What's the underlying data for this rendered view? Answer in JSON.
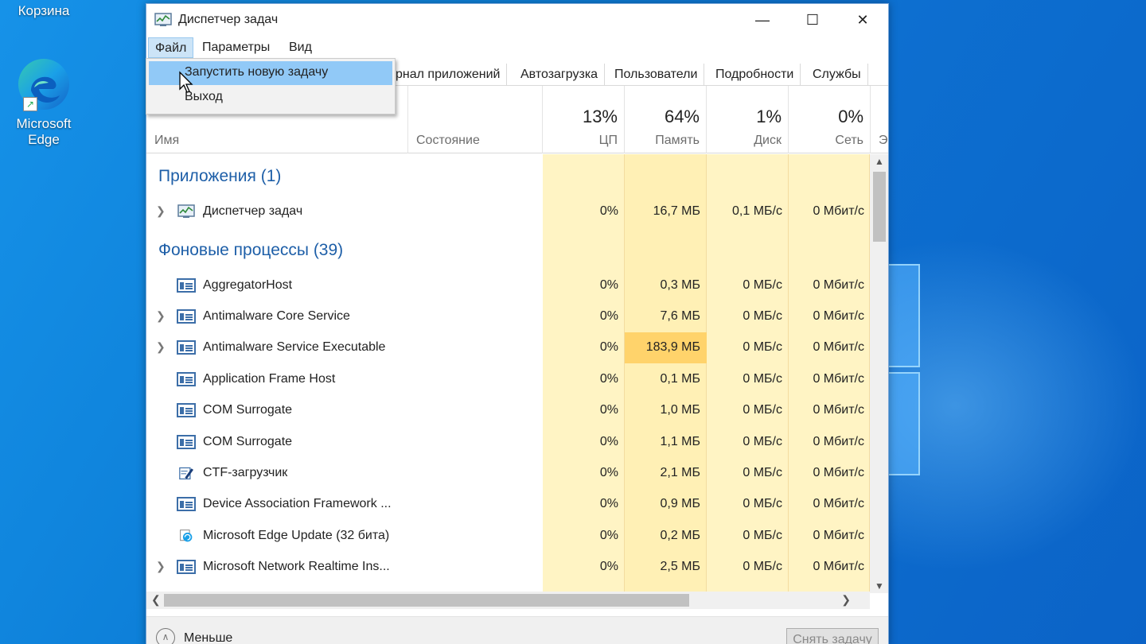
{
  "desktop": {
    "recycle_label": "Корзина",
    "edge_label_line1": "Microsoft",
    "edge_label_line2": "Edge"
  },
  "window": {
    "title": "Диспетчер задач",
    "controls": {
      "minimize": "—",
      "maximize": "☐",
      "close": "✕"
    }
  },
  "menubar": {
    "file": "Файл",
    "params": "Параметры",
    "view": "Вид"
  },
  "file_menu": {
    "run_new_task": "Запустить новую задачу",
    "exit": "Выход"
  },
  "tabs": {
    "journal": "рнал приложений",
    "autostart": "Автозагрузка",
    "users": "Пользователи",
    "details": "Подробности",
    "services": "Службы"
  },
  "columns": {
    "name": "Имя",
    "state": "Состояние",
    "cpu_pct": "13%",
    "cpu_label": "ЦП",
    "mem_pct": "64%",
    "mem_label": "Память",
    "disk_pct": "1%",
    "disk_label": "Диск",
    "net_pct": "0%",
    "net_label": "Сеть",
    "extra_label": "Э"
  },
  "groups": {
    "apps": "Приложения (1)",
    "background": "Фоновые процессы (39)"
  },
  "apps": [
    {
      "name": "Диспетчер задач",
      "cpu": "0%",
      "mem": "16,7 МБ",
      "disk": "0,1 МБ/с",
      "net": "0 Мбит/с"
    }
  ],
  "processes": [
    {
      "name": "AggregatorHost",
      "cpu": "0%",
      "mem": "0,3 МБ",
      "disk": "0 МБ/с",
      "net": "0 Мбит/с"
    },
    {
      "name": "Antimalware Core Service",
      "cpu": "0%",
      "mem": "7,6 МБ",
      "disk": "0 МБ/с",
      "net": "0 Мбит/с"
    },
    {
      "name": "Antimalware Service Executable",
      "cpu": "0%",
      "mem": "183,9 МБ",
      "disk": "0 МБ/с",
      "net": "0 Мбит/с"
    },
    {
      "name": "Application Frame Host",
      "cpu": "0%",
      "mem": "0,1 МБ",
      "disk": "0 МБ/с",
      "net": "0 Мбит/с"
    },
    {
      "name": "COM Surrogate",
      "cpu": "0%",
      "mem": "1,0 МБ",
      "disk": "0 МБ/с",
      "net": "0 Мбит/с"
    },
    {
      "name": "COM Surrogate",
      "cpu": "0%",
      "mem": "1,1 МБ",
      "disk": "0 МБ/с",
      "net": "0 Мбит/с"
    },
    {
      "name": "CTF-загрузчик",
      "cpu": "0%",
      "mem": "2,1 МБ",
      "disk": "0 МБ/с",
      "net": "0 Мбит/с"
    },
    {
      "name": "Device Association Framework ...",
      "cpu": "0%",
      "mem": "0,9 МБ",
      "disk": "0 МБ/с",
      "net": "0 Мбит/с"
    },
    {
      "name": "Microsoft Edge Update (32 бита)",
      "cpu": "0%",
      "mem": "0,2 МБ",
      "disk": "0 МБ/с",
      "net": "0 Мбит/с"
    },
    {
      "name": "Microsoft Network Realtime Ins...",
      "cpu": "0%",
      "mem": "2,5 МБ",
      "disk": "0 МБ/с",
      "net": "0 Мбит/с"
    }
  ],
  "footer": {
    "less": "Меньше",
    "end_task": "Снять задачу"
  },
  "colors": {
    "accent": "#1e5fa8",
    "mem_highlight": "#ffd36b",
    "col_bg": "#fff4c4"
  }
}
